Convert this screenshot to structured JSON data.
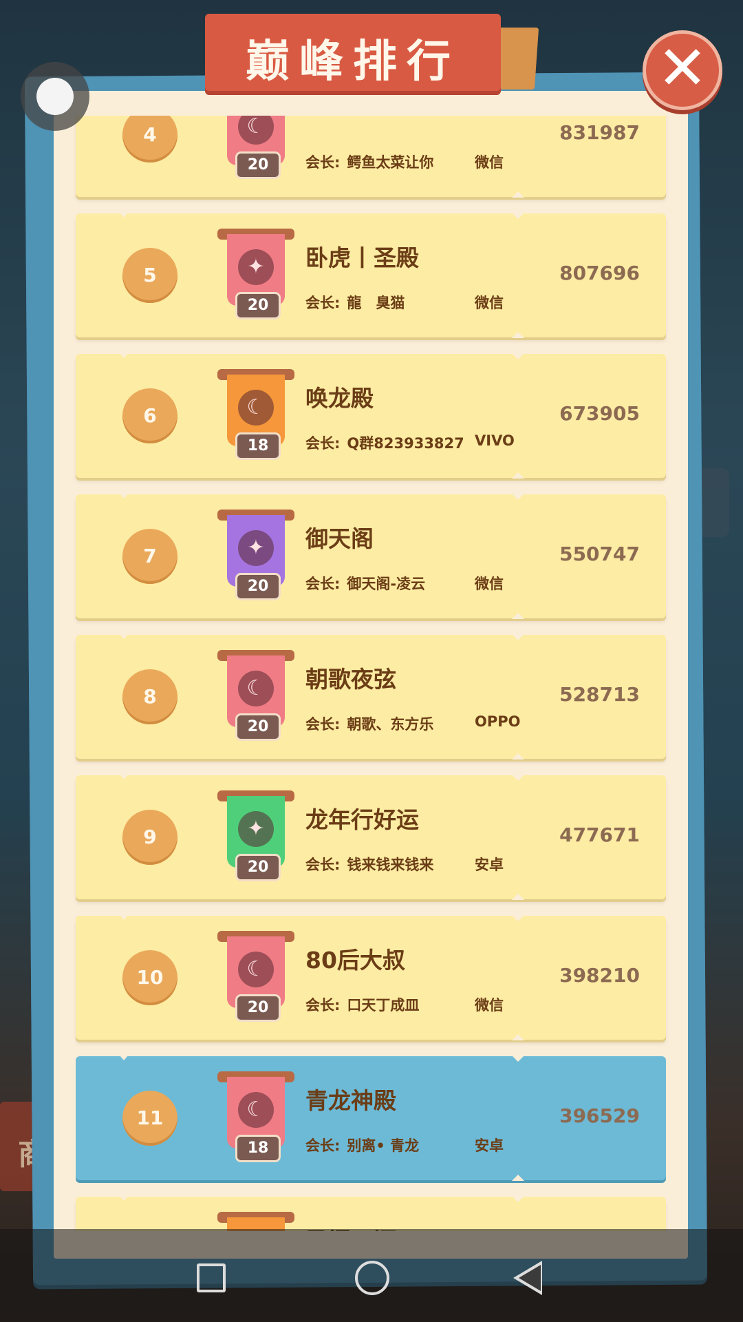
{
  "header": {
    "title": "巅峰排行",
    "close_label": "✕"
  },
  "colors": {
    "row_bg": "#fdeca3",
    "row_highlight": "#6dbad6",
    "rank_badge": "#eaa85a",
    "title_ribbon": "#d95a43",
    "close_button": "#d85d46",
    "frame": "#4f93b5"
  },
  "leader_label": "会长:",
  "rankings": [
    {
      "rank": "4",
      "name": "",
      "leader": "鳄鱼太菜让你",
      "platform": "微信",
      "score": "831987",
      "level": "20",
      "banner_color": "#f07c86",
      "emblem": "crescent-icon",
      "highlight": false
    },
    {
      "rank": "5",
      "name": "卧虎丨圣殿",
      "leader": "龍　臭猫",
      "platform": "微信",
      "score": "807696",
      "level": "20",
      "banner_color": "#f07c86",
      "emblem": "eagle-icon",
      "highlight": false
    },
    {
      "rank": "6",
      "name": "唤龙殿",
      "leader": "Q群823933827",
      "platform": "VIVO",
      "score": "673905",
      "level": "18",
      "banner_color": "#f5973a",
      "emblem": "crescent-icon",
      "highlight": false
    },
    {
      "rank": "7",
      "name": "御天阁",
      "leader": "御天阁-凌云",
      "platform": "微信",
      "score": "550747",
      "level": "20",
      "banner_color": "#a574e0",
      "emblem": "eagle-icon",
      "highlight": false
    },
    {
      "rank": "8",
      "name": "朝歌夜弦",
      "leader": "朝歌、东方乐",
      "platform": "OPPO",
      "score": "528713",
      "level": "20",
      "banner_color": "#f07c86",
      "emblem": "crescent-icon",
      "highlight": false
    },
    {
      "rank": "9",
      "name": "龙年行好运",
      "leader": "钱来钱来钱来",
      "platform": "安卓",
      "score": "477671",
      "level": "20",
      "banner_color": "#4fcf7a",
      "emblem": "eagle-icon",
      "highlight": false
    },
    {
      "rank": "10",
      "name": "80后大叔",
      "leader": "口天丁成皿",
      "platform": "微信",
      "score": "398210",
      "level": "20",
      "banner_color": "#f07c86",
      "emblem": "crescent-icon",
      "highlight": false
    },
    {
      "rank": "11",
      "name": "青龙神殿",
      "leader": "别离• 青龙",
      "platform": "安卓",
      "score": "396529",
      "level": "18",
      "banner_color": "#f07c86",
      "emblem": "crescent-icon",
      "highlight": true
    },
    {
      "rank": "",
      "name": "勇闯天涯",
      "leader": "",
      "platform": "",
      "score": "",
      "level": "",
      "banner_color": "#f5973a",
      "emblem": "eagle-icon",
      "highlight": false
    }
  ],
  "background_sign": "商",
  "navbar": {
    "recent": "recent-apps",
    "home": "home",
    "back": "back"
  }
}
